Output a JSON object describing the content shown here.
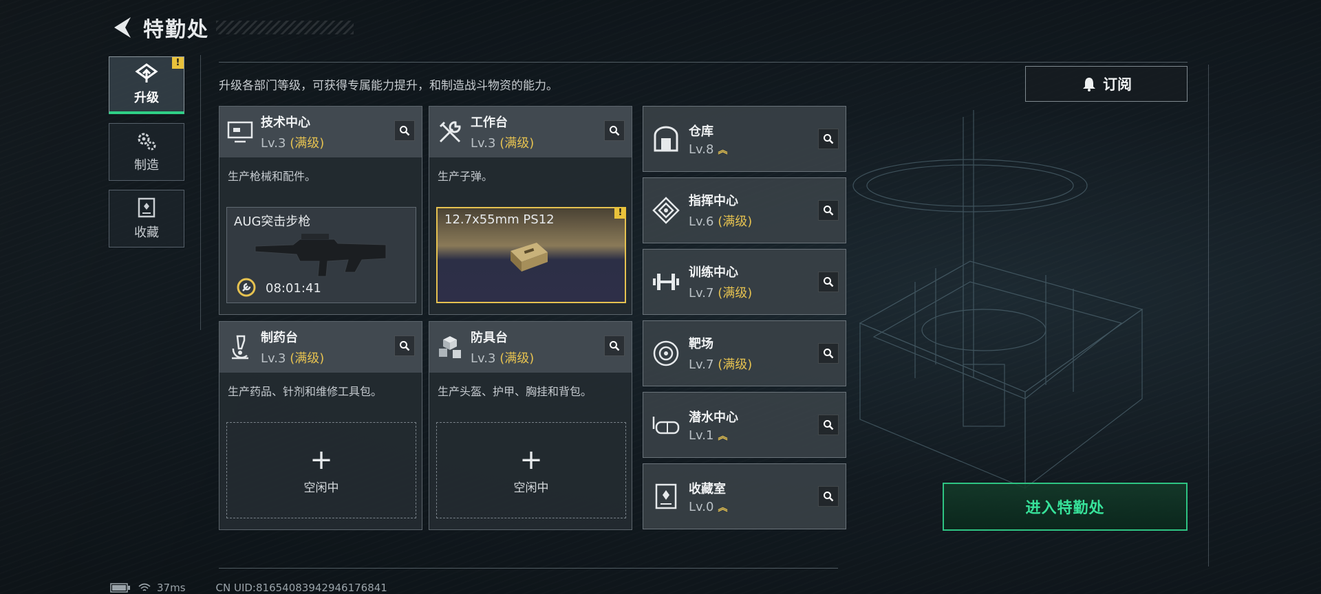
{
  "header": {
    "title": "特勤处"
  },
  "sidenav": {
    "items": [
      {
        "label": "升级",
        "active": true,
        "badge": "!"
      },
      {
        "label": "制造",
        "active": false
      },
      {
        "label": "收藏",
        "active": false
      }
    ]
  },
  "description": "升级各部门等级，可获得专属能力提升，和制造战斗物资的能力。",
  "subscribe_label": "订阅",
  "cards": [
    {
      "name": "技术中心",
      "level": "Lv.3",
      "max": "(满级)",
      "desc": "生产枪械和配件。",
      "production": {
        "item": "AUG突击步枪",
        "timer": "08:01:41"
      }
    },
    {
      "name": "工作台",
      "level": "Lv.3",
      "max": "(满级)",
      "desc": "生产子弹。",
      "production": {
        "item": "12.7x55mm PS12",
        "badge": "!"
      }
    },
    {
      "name": "制药台",
      "level": "Lv.3",
      "max": "(满级)",
      "desc": "生产药品、针剂和维修工具包。",
      "idle": "空闲中",
      "plus": "+"
    },
    {
      "name": "防具台",
      "level": "Lv.3",
      "max": "(满级)",
      "desc": "生产头盔、护甲、胸挂和背包。",
      "idle": "空闲中",
      "plus": "+"
    }
  ],
  "facilities": [
    {
      "name": "仓库",
      "level": "Lv.8",
      "max": "",
      "upgradable": true,
      "icon": "warehouse-icon"
    },
    {
      "name": "指挥中心",
      "level": "Lv.6",
      "max": "(满级)",
      "upgradable": false,
      "icon": "command-icon"
    },
    {
      "name": "训练中心",
      "level": "Lv.7",
      "max": "(满级)",
      "upgradable": false,
      "icon": "dumbbell-icon"
    },
    {
      "name": "靶场",
      "level": "Lv.7",
      "max": "(满级)",
      "upgradable": false,
      "icon": "target-icon"
    },
    {
      "name": "潜水中心",
      "level": "Lv.1",
      "max": "",
      "upgradable": true,
      "icon": "diving-mask-icon"
    },
    {
      "name": "收藏室",
      "level": "Lv.0",
      "max": "",
      "upgradable": true,
      "icon": "collection-icon"
    }
  ],
  "enter_label": "进入特勤处",
  "status": {
    "ping": "37ms",
    "uid": "CN UID:81654083942946176841"
  },
  "colors": {
    "accent_green": "#2ec483",
    "max_gold": "#e6c250",
    "alert": "#e9c23b"
  }
}
